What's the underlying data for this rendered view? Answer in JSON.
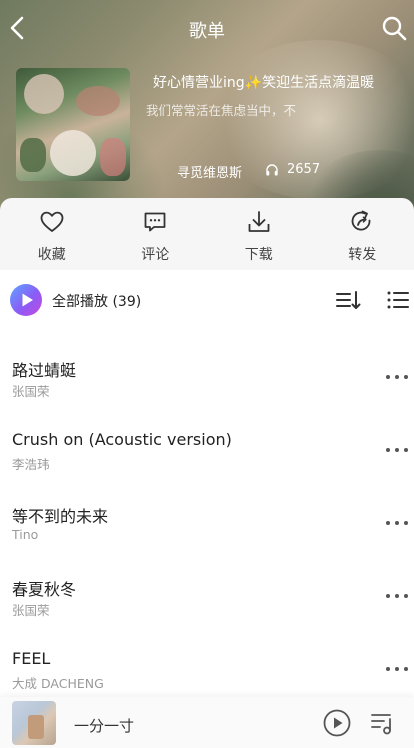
{
  "header": {
    "title": "歌单",
    "icons": {
      "back": "back-arrow-icon",
      "search": "search-icon"
    }
  },
  "playlist": {
    "title": "好心情营业ing✨笑迎生活点滴温暖",
    "description": "我们常常活在焦虑当中，不",
    "creator": "寻觅维恩斯",
    "listen_count": "2657",
    "listen_icon": "headphones-icon"
  },
  "actions": [
    {
      "label": "收藏",
      "icon": "heart-icon"
    },
    {
      "label": "评论",
      "icon": "comment-icon"
    },
    {
      "label": "下载",
      "icon": "download-icon"
    },
    {
      "label": "转发",
      "icon": "share-icon"
    }
  ],
  "play_all": {
    "label": "全部播放 (39)",
    "icons": {
      "play": "play-circle-icon",
      "sort": "sort-icon",
      "list": "list-icon"
    }
  },
  "songs": [
    {
      "title": "路过蜻蜓",
      "artist": "张国荣"
    },
    {
      "title": "Crush on (Acoustic version)",
      "artist": "李浩玮"
    },
    {
      "title": "等不到的未来",
      "artist": "Tino"
    },
    {
      "title": "春夏秋冬",
      "artist": "张国荣"
    },
    {
      "title": "FEEL",
      "artist": "大成 DACHENG"
    }
  ],
  "mini_player": {
    "title": "一分一寸",
    "icons": {
      "play": "play-icon",
      "queue": "playlist-queue-icon"
    }
  },
  "colors": {
    "accent_gradient_start": "#5da6ff",
    "accent_gradient_end": "#c54bde",
    "action_bar_bg": "#f6f6f6",
    "secondary_text": "#9a9a9a"
  }
}
